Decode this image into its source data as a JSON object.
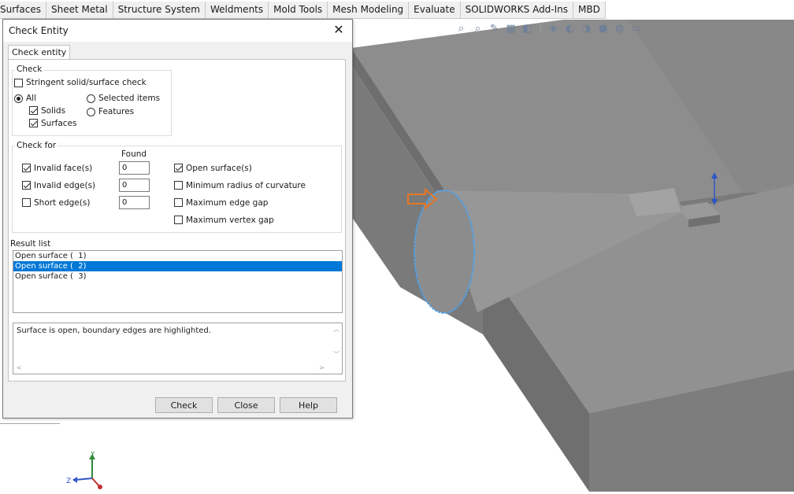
{
  "ribbon_tabs": [
    "Surfaces",
    "Sheet Metal",
    "Structure System",
    "Weldments",
    "Mold Tools",
    "Mesh Modeling",
    "Evaluate",
    "SOLIDWORKS Add-Ins",
    "MBD"
  ],
  "dialog": {
    "title": "Check Entity",
    "tab": "Check entity",
    "check_group": {
      "label": "Check",
      "stringent": "Stringent solid/surface check",
      "all": "All",
      "solids": "Solids",
      "surfaces": "Surfaces",
      "selected_items": "Selected items",
      "features": "Features"
    },
    "check_for": {
      "label": "Check for",
      "found_header": "Found",
      "invalid_faces": "Invalid face(s)",
      "invalid_edges": "Invalid edge(s)",
      "short_edges": "Short edge(s)",
      "invalid_faces_found": "0",
      "invalid_edges_found": "0",
      "short_edges_found": "0",
      "open_surfaces": "Open surface(s)",
      "min_radius": "Minimum radius of curvature",
      "max_edge_gap": "Maximum edge gap",
      "max_vertex_gap": "Maximum vertex gap"
    },
    "result_list": {
      "label": "Result list",
      "items": [
        "Open surface (  1)",
        "Open surface (  2)",
        "Open surface (  3)"
      ],
      "selected_index": 1
    },
    "message": "Surface is open, boundary edges are highlighted.",
    "buttons": {
      "check": "Check",
      "close": "Close",
      "help": "Help"
    }
  },
  "triad": {
    "y": "Y",
    "z": "Z"
  },
  "colors": {
    "highlight": "#0078d7",
    "model_face": "#8f8f8f",
    "edge_highlight": "#4aa3f0",
    "arrow": "#e87722"
  }
}
